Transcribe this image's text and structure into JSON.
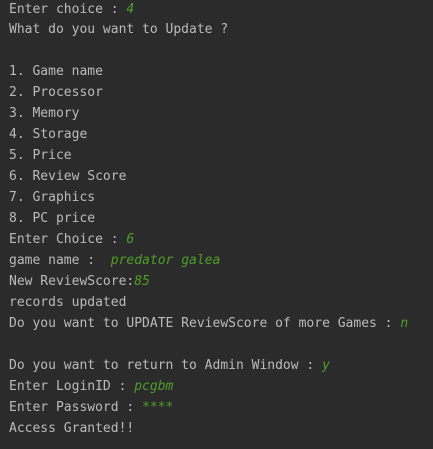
{
  "console": {
    "lines": [
      {
        "prompt": "Enter choice : ",
        "input": "4"
      },
      {
        "prompt": "What do you want to Update ?",
        "input": ""
      },
      {
        "prompt": "",
        "input": ""
      },
      {
        "prompt": "1. Game name",
        "input": ""
      },
      {
        "prompt": "2. Processor",
        "input": ""
      },
      {
        "prompt": "3. Memory",
        "input": ""
      },
      {
        "prompt": "4. Storage",
        "input": ""
      },
      {
        "prompt": "5. Price",
        "input": ""
      },
      {
        "prompt": "6. Review Score",
        "input": ""
      },
      {
        "prompt": "7. Graphics",
        "input": ""
      },
      {
        "prompt": "8. PC price",
        "input": ""
      },
      {
        "prompt": "Enter Choice : ",
        "input": "6"
      },
      {
        "prompt": "game name :  ",
        "input": "predator galea"
      },
      {
        "prompt": "New ReviewScore:",
        "input": "85"
      },
      {
        "prompt": "records updated",
        "input": ""
      },
      {
        "prompt": "Do you want to UPDATE ReviewScore of more Games : ",
        "input": "n"
      },
      {
        "prompt": "",
        "input": ""
      },
      {
        "prompt": "Do you want to return to Admin Window : ",
        "input": "y"
      },
      {
        "prompt": "Enter LoginID : ",
        "input": "pcgbm"
      },
      {
        "prompt": "Enter Password : ",
        "input": "****"
      },
      {
        "prompt": "Access Granted!!",
        "input": ""
      }
    ]
  },
  "colors": {
    "background": "#2b2b2b",
    "output_text": "#bbbbbb",
    "user_input": "#4f9e29"
  }
}
